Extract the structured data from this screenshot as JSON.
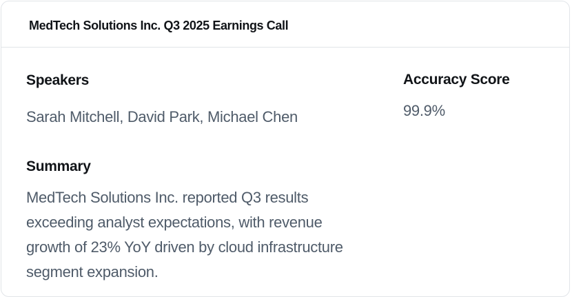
{
  "card": {
    "title": "MedTech Solutions Inc. Q3 2025 Earnings Call"
  },
  "speakers": {
    "heading": "Speakers",
    "value": "Sarah Mitchell, David Park, Michael Chen"
  },
  "summary": {
    "heading": "Summary",
    "text": "MedTech Solutions Inc. reported Q3 results exceeding analyst expectations, with revenue growth of 23% YoY driven by cloud infrastructure segment expansion."
  },
  "accuracy": {
    "heading": "Accuracy Score",
    "value": "99.9%"
  },
  "colors": {
    "heading_text": "#111418",
    "body_text": "#4f5b69",
    "border": "#e1e4e8",
    "background": "#ffffff"
  }
}
